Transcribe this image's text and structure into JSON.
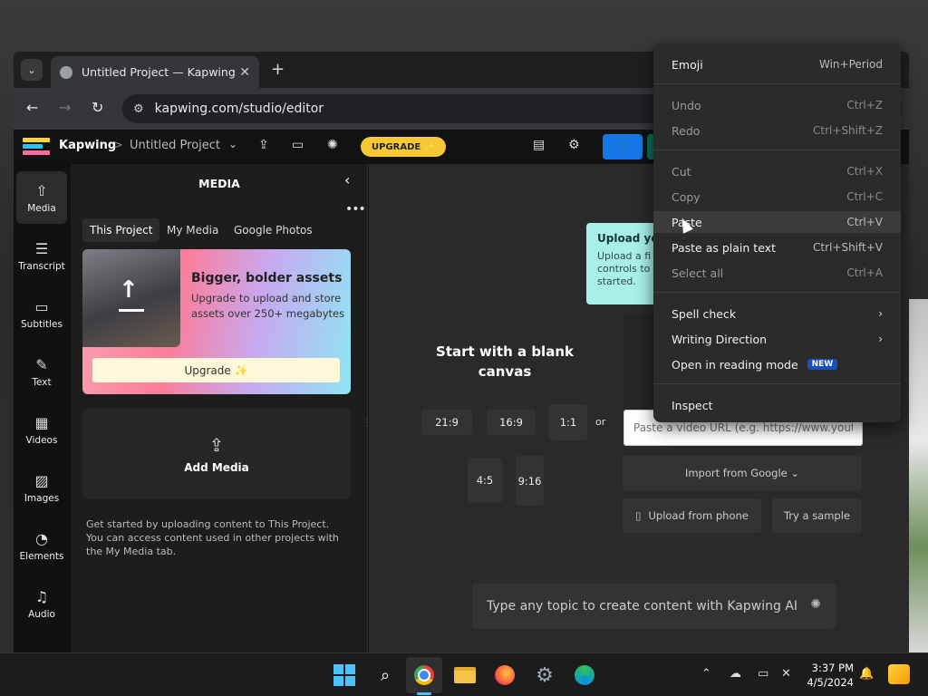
{
  "browser": {
    "tab_title": "Untitled Project — Kapwing",
    "url": "kapwing.com/studio/editor"
  },
  "app": {
    "brand": "Kapwing",
    "breadcrumb_sep": ">",
    "project_name": "Untitled Project",
    "upgrade_pill": "UPGRADE ✨",
    "logo_colors": [
      "#ffd23f",
      "#29c5f6",
      "#ff6b9a"
    ],
    "accent": "#1578e6"
  },
  "rail": {
    "items": [
      {
        "label": "Media",
        "icon": "upload-cloud-icon",
        "glyph": "⇧"
      },
      {
        "label": "Transcript",
        "icon": "transcript-icon",
        "glyph": "☰"
      },
      {
        "label": "Subtitles",
        "icon": "subtitles-icon",
        "glyph": "▭"
      },
      {
        "label": "Text",
        "icon": "text-edit-icon",
        "glyph": "✎"
      },
      {
        "label": "Videos",
        "icon": "film-icon",
        "glyph": "▦"
      },
      {
        "label": "Images",
        "icon": "image-icon",
        "glyph": "▨"
      },
      {
        "label": "Elements",
        "icon": "shapes-icon",
        "glyph": "◔"
      },
      {
        "label": "Audio",
        "icon": "music-note-icon",
        "glyph": "♫"
      }
    ]
  },
  "media_panel": {
    "title": "MEDIA",
    "tabs": [
      "This Project",
      "My Media",
      "Google Photos"
    ],
    "promo": {
      "title": "Bigger, bolder assets",
      "body": "Upgrade to upload and store assets over 250+ megabytes",
      "cta": "Upgrade ✨"
    },
    "add_media": "Add Media",
    "help": "Get started by uploading content to This Project. You can access content used in other projects with the My Media tab."
  },
  "canvas": {
    "blank_title": "Start with a blank canvas",
    "ratios": [
      "21:9",
      "16:9",
      "1:1",
      "4:5",
      "9:16"
    ],
    "or": "or",
    "tooltip_title": "Upload you",
    "tooltip_body": [
      "Upload a fi",
      "controls to",
      "started."
    ],
    "url_placeholder": "Paste a video URL (e.g. https://www.youtub",
    "import_google": "Import from Google ⌄",
    "upload_phone": "Upload from phone",
    "try_sample": "Try a sample",
    "ai_prompt": "Type any topic to create content with Kapwing AI"
  },
  "context_menu": {
    "emoji": {
      "label": "Emoji",
      "key": "Win+Period"
    },
    "undo": {
      "label": "Undo",
      "key": "Ctrl+Z"
    },
    "redo": {
      "label": "Redo",
      "key": "Ctrl+Shift+Z"
    },
    "cut": {
      "label": "Cut",
      "key": "Ctrl+X"
    },
    "copy": {
      "label": "Copy",
      "key": "Ctrl+C"
    },
    "paste": {
      "label": "Paste",
      "key": "Ctrl+V"
    },
    "paste_plain": {
      "label": "Paste as plain text",
      "key": "Ctrl+Shift+V"
    },
    "select_all": {
      "label": "Select all",
      "key": "Ctrl+A"
    },
    "spell_check": {
      "label": "Spell check"
    },
    "writing_direction": {
      "label": "Writing Direction"
    },
    "reading_mode": {
      "label": "Open in reading mode",
      "badge": "NEW"
    },
    "inspect": {
      "label": "Inspect"
    }
  },
  "taskbar": {
    "time": "3:37 PM",
    "date": "4/5/2024"
  }
}
